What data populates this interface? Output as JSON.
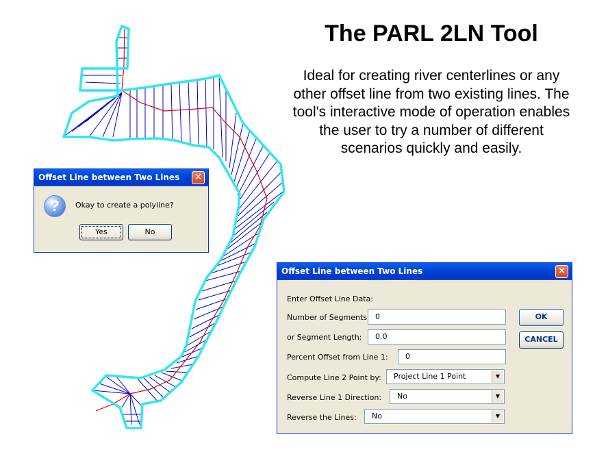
{
  "slide": {
    "title": "The PARL 2LN Tool",
    "description": "Ideal for creating river centerlines or any other offset line from two existing lines.  The tool's interactive mode of operation enables the user to try a number of different scenarios quickly and easily."
  },
  "colors": {
    "river_banks": "#33e6ee",
    "offset_lines": "#0000cc",
    "centerline": "#e00000",
    "titlebar": "#0147d6"
  },
  "confirm_dialog": {
    "title": "Offset Line between Two Lines",
    "close": "✕",
    "icon": "question-icon",
    "icon_glyph": "?",
    "message": "Okay to create a polyline?",
    "yes_label": "Yes",
    "no_label": "No"
  },
  "offset_dialog": {
    "title": "Offset Line between Two Lines",
    "close": "✕",
    "section_label": "Enter Offset Line Data:",
    "fields": {
      "segments": {
        "label": "Number of Segments:",
        "value": "0"
      },
      "segment_length": {
        "label": "or  Segment Length:",
        "value": "0.0"
      },
      "percent_offset": {
        "label": "Percent Offset from Line 1:",
        "value": "0"
      },
      "compute_line2": {
        "label": "Compute Line 2 Point by:",
        "value": "Project Line 1 Point"
      },
      "reverse_line1": {
        "label": "Reverse Line 1 Direction:",
        "value": "No"
      },
      "reverse_lines": {
        "label": "Reverse the Lines:",
        "value": "No"
      }
    },
    "ok_label": "OK",
    "cancel_label": "CANCEL",
    "dropdown_arrow": "▼"
  }
}
